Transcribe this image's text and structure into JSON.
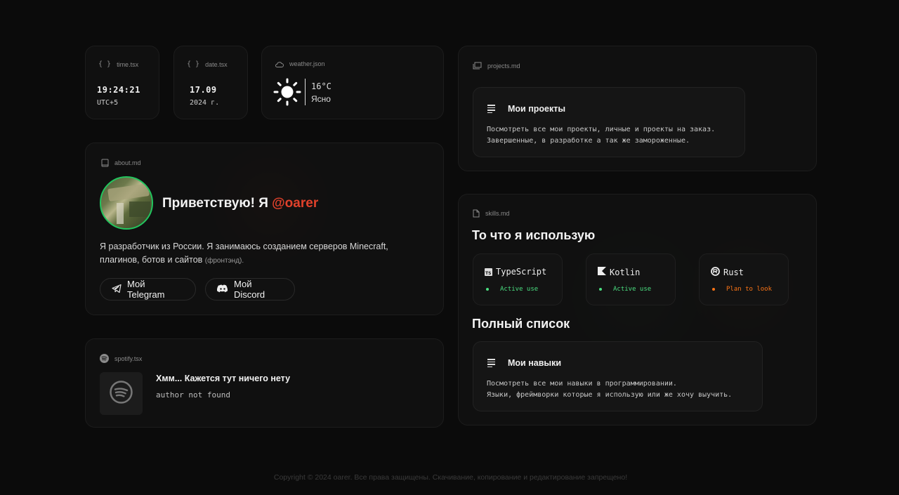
{
  "time_card": {
    "file": "time.tsx",
    "time": "19:24:21",
    "tz": "UTC+5"
  },
  "date_card": {
    "file": "date.tsx",
    "date": "17.09",
    "year": "2024 г."
  },
  "weather_card": {
    "file": "weather.json",
    "temp": "16°C",
    "condition": "Ясно"
  },
  "about_card": {
    "file": "about.md",
    "greeting": "Приветствую! Я ",
    "handle": "@oarer",
    "bio": "Я разработчик из России. Я занимаюсь созданием серверов Minecraft, плагинов, ботов и сайтов",
    "bio_note": "(фронтэнд).",
    "telegram_label": "Мой Telegram",
    "discord_label": "Мой Discord"
  },
  "spotify_card": {
    "file": "spotify.tsx",
    "title": "Хмм... Кажется тут ничего нету",
    "subtitle": "author not found"
  },
  "projects_card": {
    "file": "projects.md",
    "title": "Мои проекты",
    "desc1": "Посмотреть все мои проекты, личные и проекты на заказ.",
    "desc2": "Завершенные, в разработке а так же замороженные."
  },
  "skills_card": {
    "file": "skills.md",
    "heading": "То что я использую",
    "skills": [
      {
        "name": "TypeScript",
        "status": "Active use",
        "color": "#4ade80"
      },
      {
        "name": "Kotlin",
        "status": "Active use",
        "color": "#4ade80"
      },
      {
        "name": "Rust",
        "status": "Plan to look",
        "color": "#f97316"
      }
    ],
    "full_list_heading": "Полный список",
    "list_title": "Мои навыки",
    "list_desc1": "Посмотреть все мои навыки в программировании.",
    "list_desc2": "Языки, фреймворки которые я использую или же хочу выучить."
  },
  "footer": "Copyright © 2024 oarer. Все права защищены. Скачивание, копирование и редактирование запрещено!",
  "colors": {
    "accent": "#e0412b",
    "border": "#1d1d1d",
    "avatar_ring": "#22c55e"
  }
}
